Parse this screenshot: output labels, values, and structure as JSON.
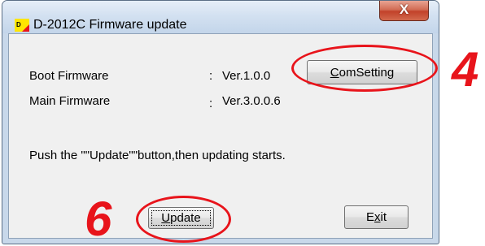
{
  "window": {
    "title": "D-2012C Firmware update",
    "icon": "d-logo-icon",
    "close_label": "X"
  },
  "firmware": [
    {
      "label": "Boot Firmware",
      "sep": ":",
      "version": "Ver.1.0.0"
    },
    {
      "label": "Main Firmware",
      "sep": ":",
      "version": "Ver.3.0.0.6"
    }
  ],
  "message": "Push the \"\"Update\"\"button,then updating starts.",
  "buttons": {
    "comsetting": {
      "label": "ComSetting",
      "mnemonic": "C",
      "rest": "omSetting"
    },
    "update": {
      "label": "Update",
      "mnemonic": "U",
      "rest": "pdate"
    },
    "exit": {
      "label": "Exit",
      "pre": "E",
      "mnemonic": "x",
      "rest": "it"
    }
  },
  "annotations": {
    "step4": "4",
    "step6": "6",
    "color": "#e8141b"
  }
}
